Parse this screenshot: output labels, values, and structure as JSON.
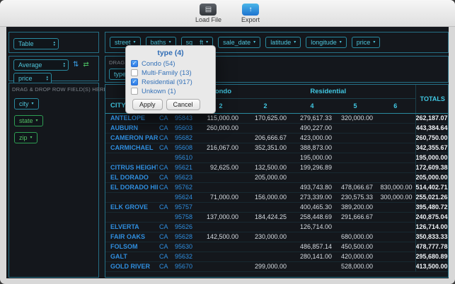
{
  "toolbar": {
    "load_file_label": "Load File",
    "export_label": "Export"
  },
  "icons": {
    "load_file": "▤",
    "export": "↑",
    "select_up": "▴",
    "select_down": "▾",
    "chip_caret": "▾",
    "row_order": "⇅",
    "col_order": "⇄",
    "check": "✓"
  },
  "controls": {
    "renderer": "Table",
    "aggregator": "Average",
    "aggregator_field": "price",
    "row_drop_hint": "DRAG & DROP ROW FIELD(S) HERE",
    "col_drop_hint": "DRAG & DROP COLUMN FIELD(S) HERE"
  },
  "unused_fields": [
    "street",
    "baths",
    "sq__ft",
    "sale_date",
    "latitude",
    "longitude",
    "price"
  ],
  "row_fields": [
    {
      "label": "city",
      "color": "teal"
    },
    {
      "label": "state",
      "color": "green"
    },
    {
      "label": "zip",
      "color": "green"
    }
  ],
  "col_fields": [
    {
      "label": "type",
      "color": "teal"
    }
  ],
  "filter_popup": {
    "title": "type (4)",
    "options": [
      {
        "label": "Condo (54)",
        "checked": true
      },
      {
        "label": "Multi-Family (13)",
        "checked": false
      },
      {
        "label": "Residential (917)",
        "checked": true
      },
      {
        "label": "Unkown (1)",
        "checked": false
      }
    ],
    "apply_label": "Apply",
    "cancel_label": "Cancel"
  },
  "pivot": {
    "corner_label": "CITY",
    "totals_label": "TOTALS",
    "col_groups": [
      {
        "label": "Condo",
        "cols": [
          "2"
        ]
      },
      {
        "label": "Residential",
        "cols": [
          "2",
          "4",
          "5",
          "6"
        ]
      }
    ],
    "rows": [
      {
        "city": "ANTELOPE",
        "state": "CA",
        "zip": "95843",
        "values": [
          "115,000.00",
          "170,625.00",
          "279,617.33",
          "320,000.00",
          ""
        ],
        "total": "262,187.07"
      },
      {
        "city": "AUBURN",
        "state": "CA",
        "zip": "95603",
        "values": [
          "260,000.00",
          "",
          "490,227.00",
          "",
          ""
        ],
        "total": "443,384.64"
      },
      {
        "city": "CAMERON PARK",
        "state": "CA",
        "zip": "95682",
        "values": [
          "",
          "206,666.67",
          "423,000.00",
          "",
          ""
        ],
        "total": "260,750.00"
      },
      {
        "city": "CARMICHAEL",
        "state": "CA",
        "zip": "95608",
        "values": [
          "216,067.00",
          "352,351.00",
          "388,873.00",
          "",
          ""
        ],
        "total": "342,355.67"
      },
      {
        "city": "",
        "state": "",
        "zip": "95610",
        "values": [
          "",
          "",
          "195,000.00",
          "",
          ""
        ],
        "total": "195,000.00"
      },
      {
        "city": "CITRUS HEIGHTS",
        "state": "CA",
        "zip": "95621",
        "values": [
          "92,625.00",
          "132,500.00",
          "199,296.89",
          "",
          ""
        ],
        "total": "172,609.38"
      },
      {
        "city": "EL DORADO",
        "state": "CA",
        "zip": "95623",
        "values": [
          "",
          "205,000.00",
          "",
          "",
          ""
        ],
        "total": "205,000.00"
      },
      {
        "city": "EL DORADO HILLS",
        "state": "CA",
        "zip": "95762",
        "values": [
          "",
          "",
          "493,743.80",
          "478,066.67",
          "830,000.00"
        ],
        "total": "514,402.71"
      },
      {
        "city": "",
        "state": "",
        "zip": "95624",
        "values": [
          "71,000.00",
          "156,000.00",
          "273,339.00",
          "230,575.33",
          "300,000.00"
        ],
        "total": "255,021.26"
      },
      {
        "city": "ELK GROVE",
        "state": "CA",
        "zip": "95757",
        "values": [
          "",
          "",
          "400,465.30",
          "389,200.00",
          ""
        ],
        "total": "395,480.72"
      },
      {
        "city": "",
        "state": "",
        "zip": "95758",
        "values": [
          "137,000.00",
          "184,424.25",
          "258,448.69",
          "291,666.67",
          ""
        ],
        "total": "240,875.04"
      },
      {
        "city": "ELVERTA",
        "state": "CA",
        "zip": "95626",
        "values": [
          "",
          "",
          "126,714.00",
          "",
          ""
        ],
        "total": "126,714.00"
      },
      {
        "city": "FAIR OAKS",
        "state": "CA",
        "zip": "95628",
        "values": [
          "142,500.00",
          "230,000.00",
          "",
          "680,000.00",
          ""
        ],
        "total": "350,833.33"
      },
      {
        "city": "FOLSOM",
        "state": "CA",
        "zip": "95630",
        "values": [
          "",
          "",
          "486,857.14",
          "450,500.00",
          ""
        ],
        "total": "478,777.78"
      },
      {
        "city": "GALT",
        "state": "CA",
        "zip": "95632",
        "values": [
          "",
          "",
          "280,141.00",
          "420,000.00",
          ""
        ],
        "total": "295,680.89"
      },
      {
        "city": "GOLD RIVER",
        "state": "CA",
        "zip": "95670",
        "values": [
          "",
          "299,000.00",
          "",
          "528,000.00",
          ""
        ],
        "total": "413,500.00"
      }
    ]
  },
  "colors": {
    "accent_teal": "#2a8aa0",
    "chip_teal": "#4fc4da",
    "chip_green": "#55c065",
    "header_teal": "#41c8e3",
    "row_label_blue": "#2f8fe0",
    "value_text": "#d7dde3",
    "popup_text": "#3572b8",
    "checkbox_blue": "#2c7ae8"
  }
}
